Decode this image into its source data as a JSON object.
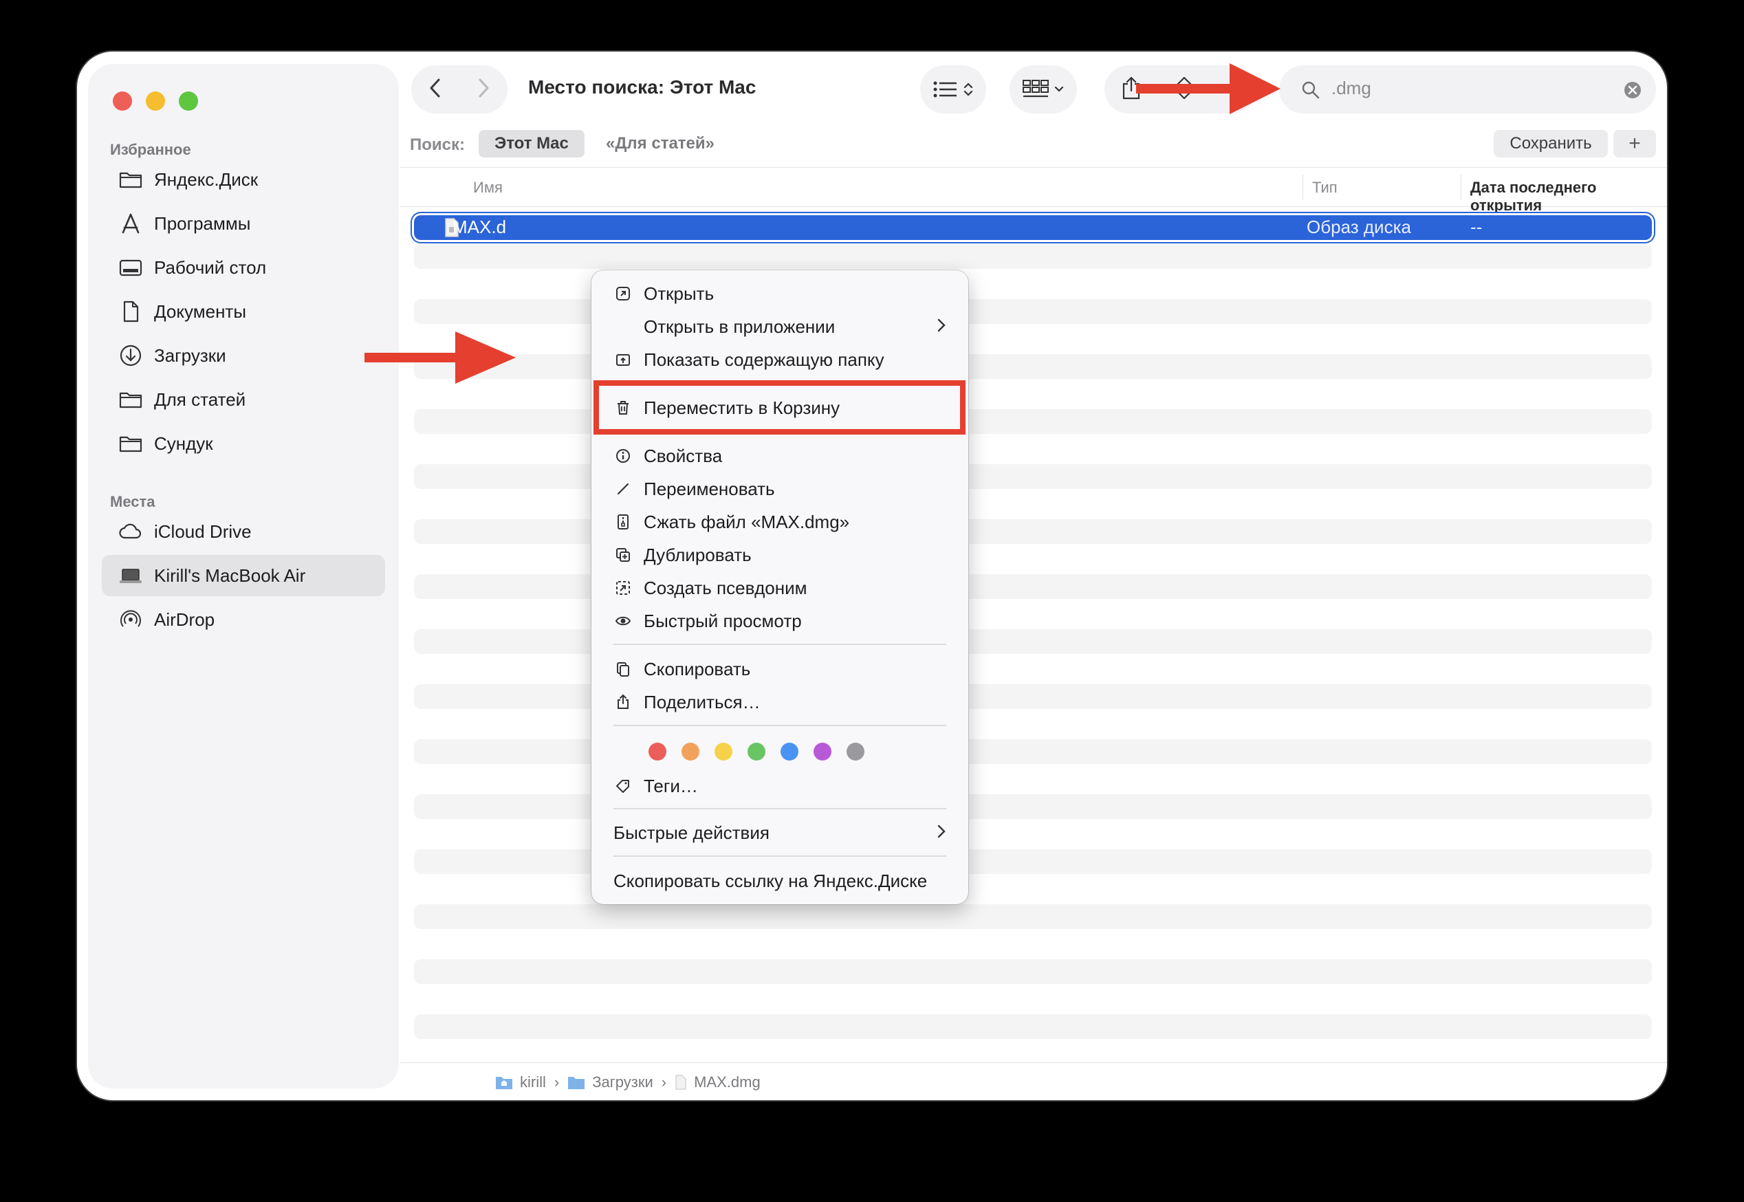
{
  "window": {
    "title": "Место поиска: Этот Mac"
  },
  "sidebar": {
    "favorites_title": "Избранное",
    "favorites": [
      {
        "label": "Яндекс.Диск",
        "icon": "folder-icon"
      },
      {
        "label": "Программы",
        "icon": "applications-icon"
      },
      {
        "label": "Рабочий стол",
        "icon": "desktop-icon"
      },
      {
        "label": "Документы",
        "icon": "document-icon"
      },
      {
        "label": "Загрузки",
        "icon": "downloads-icon"
      },
      {
        "label": "Для статей",
        "icon": "folder-icon"
      },
      {
        "label": "Сундук",
        "icon": "folder-icon"
      }
    ],
    "places_title": "Места",
    "places": [
      {
        "label": "iCloud Drive",
        "icon": "cloud-icon"
      },
      {
        "label": "Kirill's MacBook Air",
        "icon": "laptop-icon",
        "selected": true
      },
      {
        "label": "AirDrop",
        "icon": "airdrop-icon"
      }
    ]
  },
  "search": {
    "value": ".dmg"
  },
  "scope": {
    "label": "Поиск:",
    "active": "Этот Mac",
    "other": "«Для статей»",
    "save": "Сохранить",
    "add": "+"
  },
  "columns": {
    "name": "Имя",
    "kind": "Тип",
    "date": "Дата последнего открытия"
  },
  "file": {
    "name": "MAX.dmg",
    "name_visible": "MAX.d",
    "kind": "Образ диска",
    "date": "--"
  },
  "path": {
    "items": [
      "kirill",
      "Загрузки",
      "MAX.dmg"
    ]
  },
  "context_menu": {
    "open": "Открыть",
    "open_with": "Открыть в приложении",
    "show_folder": "Показать содержащую папку",
    "move_to_trash": "Переместить в Корзину",
    "get_info": "Свойства",
    "rename": "Переименовать",
    "compress": "Сжать файл «MAX.dmg»",
    "duplicate": "Дублировать",
    "make_alias": "Создать псевдоним",
    "quick_look": "Быстрый просмотр",
    "copy": "Скопировать",
    "share": "Поделиться…",
    "tags": "Теги…",
    "quick_actions": "Быстрые действия",
    "copy_yandex_link": "Скопировать ссылку на Яндекс.Диске",
    "tag_colors": [
      "#ec5e5a",
      "#f2a15c",
      "#f5d24a",
      "#69c464",
      "#4b93f0",
      "#b85ad8",
      "#9a9a9e"
    ]
  },
  "annotation_color": "#e53f2f",
  "accent_color": "#2b63d9"
}
